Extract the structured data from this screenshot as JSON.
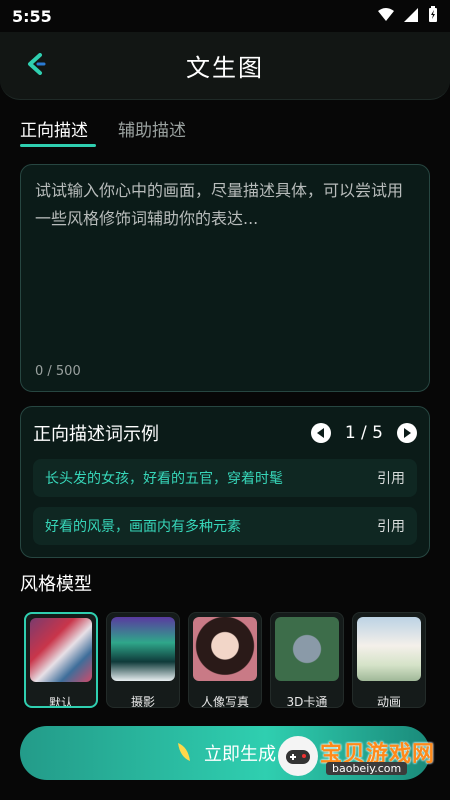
{
  "status_bar": {
    "time": "5:55"
  },
  "header": {
    "title": "文生图"
  },
  "tabs": [
    {
      "label": "正向描述",
      "active": true
    },
    {
      "label": "辅助描述",
      "active": false
    }
  ],
  "prompt": {
    "placeholder": "试试输入你心中的画面，尽量描述具体，可以尝试用一些风格修饰词辅助你的表达...",
    "value": "",
    "counter": "0 / 500"
  },
  "examples": {
    "title": "正向描述词示例",
    "page": "1 / 5",
    "items": [
      {
        "text": "长头发的女孩，好看的五官，穿着时髦",
        "action": "引用"
      },
      {
        "text": "好看的风景，画面内有多种元素",
        "action": "引用"
      }
    ]
  },
  "style_models": {
    "title": "风格模型",
    "items": [
      {
        "label": "默认",
        "selected": true
      },
      {
        "label": "摄影",
        "selected": false
      },
      {
        "label": "人像写真",
        "selected": false
      },
      {
        "label": "3D卡通",
        "selected": false
      },
      {
        "label": "动画",
        "selected": false
      }
    ]
  },
  "cta": {
    "label": "立即生成"
  },
  "watermark": {
    "main": "宝贝游戏网",
    "sub": "baobeiy.com"
  },
  "colors": {
    "accent": "#2fcfb0",
    "background": "#070707",
    "panel": "#0b1b18"
  }
}
